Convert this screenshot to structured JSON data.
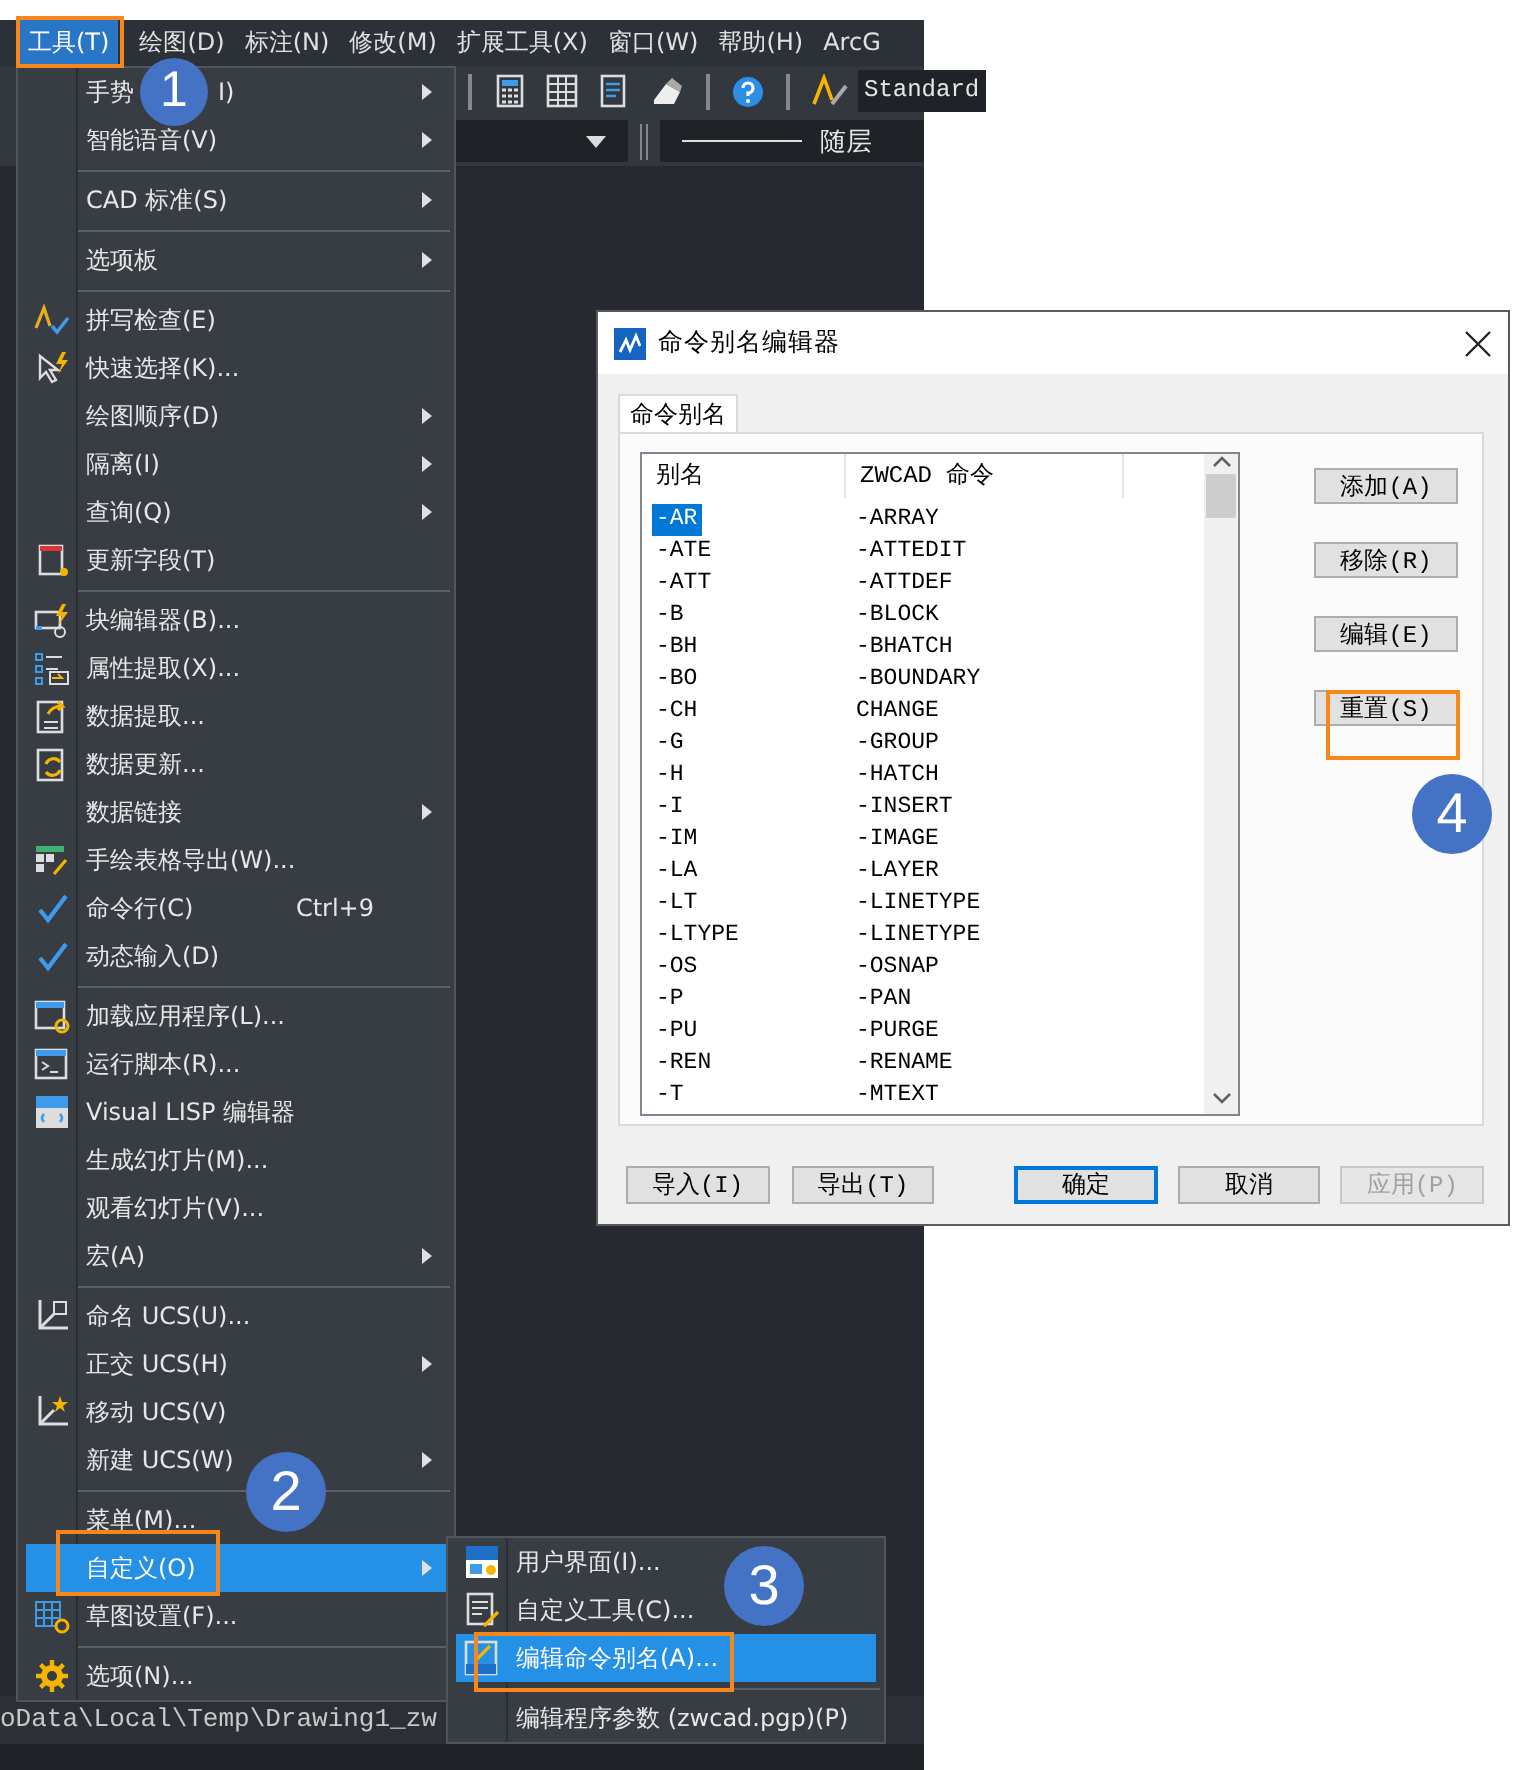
{
  "menu_bar": {
    "items": [
      {
        "label": "工具(T)",
        "selected": true
      },
      {
        "label": "绘图(D)",
        "selected": false
      },
      {
        "label": "标注(N)",
        "selected": false
      },
      {
        "label": "修改(M)",
        "selected": false
      },
      {
        "label": "扩展工具(X)",
        "selected": false
      },
      {
        "label": "窗口(W)",
        "selected": false
      },
      {
        "label": "帮助(H)",
        "selected": false
      },
      {
        "label": "ArcG",
        "selected": false
      }
    ]
  },
  "toolbar": {
    "text_style": "Standard",
    "linetype": "随层"
  },
  "tools_menu": {
    "items": [
      {
        "kind": "command",
        "label": "手势",
        "label_end": "I)",
        "submenu": true,
        "checked": false,
        "selected": false
      },
      {
        "kind": "command",
        "label": "智能语音(V)",
        "submenu": true,
        "checked": false,
        "selected": false
      },
      {
        "kind": "separator"
      },
      {
        "kind": "command",
        "label": "CAD 标准(S)",
        "submenu": true,
        "checked": false,
        "selected": false
      },
      {
        "kind": "separator"
      },
      {
        "kind": "command",
        "label": "选项板",
        "submenu": true,
        "checked": false,
        "selected": false
      },
      {
        "kind": "separator"
      },
      {
        "kind": "command",
        "label": "拼写检查(E)",
        "submenu": false,
        "checked": false,
        "selected": false
      },
      {
        "kind": "command",
        "label": "快速选择(K)...",
        "submenu": false,
        "checked": false,
        "selected": false
      },
      {
        "kind": "command",
        "label": "绘图顺序(D)",
        "submenu": true,
        "checked": false,
        "selected": false
      },
      {
        "kind": "command",
        "label": "隔离(I)",
        "submenu": true,
        "checked": false,
        "selected": false
      },
      {
        "kind": "command",
        "label": "查询(Q)",
        "submenu": true,
        "checked": false,
        "selected": false
      },
      {
        "kind": "command",
        "label": "更新字段(T)",
        "submenu": false,
        "checked": false,
        "selected": false
      },
      {
        "kind": "separator"
      },
      {
        "kind": "command",
        "label": "块编辑器(B)...",
        "submenu": false,
        "checked": false,
        "selected": false
      },
      {
        "kind": "command",
        "label": "属性提取(X)...",
        "submenu": false,
        "checked": false,
        "selected": false
      },
      {
        "kind": "command",
        "label": "数据提取...",
        "submenu": false,
        "checked": false,
        "selected": false
      },
      {
        "kind": "command",
        "label": "数据更新...",
        "submenu": false,
        "checked": false,
        "selected": false
      },
      {
        "kind": "command",
        "label": "数据链接",
        "submenu": true,
        "checked": false,
        "selected": false
      },
      {
        "kind": "command",
        "label": "手绘表格导出(W)...",
        "submenu": false,
        "checked": false,
        "selected": false
      },
      {
        "kind": "command",
        "label": "命令行(C)",
        "shortcut": "Ctrl+9",
        "submenu": false,
        "checked": true,
        "selected": false
      },
      {
        "kind": "command",
        "label": "动态输入(D)",
        "submenu": false,
        "checked": true,
        "selected": false
      },
      {
        "kind": "separator"
      },
      {
        "kind": "command",
        "label": "加载应用程序(L)...",
        "submenu": false,
        "checked": false,
        "selected": false
      },
      {
        "kind": "command",
        "label": "运行脚本(R)...",
        "submenu": false,
        "checked": false,
        "selected": false
      },
      {
        "kind": "command",
        "label": "Visual LISP 编辑器",
        "submenu": false,
        "checked": false,
        "selected": false
      },
      {
        "kind": "command",
        "label": "生成幻灯片(M)...",
        "submenu": false,
        "checked": false,
        "selected": false
      },
      {
        "kind": "command",
        "label": "观看幻灯片(V)...",
        "submenu": false,
        "checked": false,
        "selected": false
      },
      {
        "kind": "command",
        "label": "宏(A)",
        "submenu": true,
        "checked": false,
        "selected": false
      },
      {
        "kind": "separator"
      },
      {
        "kind": "command",
        "label": "命名 UCS(U)...",
        "submenu": false,
        "checked": false,
        "selected": false
      },
      {
        "kind": "command",
        "label": "正交 UCS(H)",
        "submenu": true,
        "checked": false,
        "selected": false
      },
      {
        "kind": "command",
        "label": "移动 UCS(V)",
        "submenu": false,
        "checked": false,
        "selected": false
      },
      {
        "kind": "command",
        "label": "新建 UCS(W)",
        "submenu": true,
        "checked": false,
        "selected": false
      },
      {
        "kind": "separator"
      },
      {
        "kind": "command",
        "label": "菜单(M)...",
        "submenu": false,
        "checked": false,
        "selected": false
      },
      {
        "kind": "command",
        "label": "自定义(O)",
        "submenu": true,
        "checked": false,
        "selected": true
      },
      {
        "kind": "command",
        "label": "草图设置(F)...",
        "submenu": false,
        "checked": false,
        "selected": false
      },
      {
        "kind": "separator"
      },
      {
        "kind": "command",
        "label": "选项(N)...",
        "submenu": false,
        "checked": false,
        "selected": false
      }
    ]
  },
  "customize_menu": {
    "items": [
      {
        "kind": "command",
        "label": "用户界面(I)...",
        "submenu": false,
        "checked": false,
        "selected": false
      },
      {
        "kind": "command",
        "label": "自定义工具(C)...",
        "submenu": false,
        "checked": false,
        "selected": false
      },
      {
        "kind": "command",
        "label": "编辑命令别名(A)...",
        "submenu": false,
        "checked": false,
        "selected": true
      },
      {
        "kind": "separator"
      },
      {
        "kind": "command",
        "label": "编辑程序参数 (zwcad.pgp)(P)",
        "submenu": false,
        "checked": false,
        "selected": false
      }
    ]
  },
  "dialog": {
    "title": "命令别名编辑器",
    "tabs": [
      {
        "label": "命令别名",
        "selected": true
      }
    ],
    "table": {
      "columns": [
        "别名",
        "ZWCAD 命令"
      ],
      "rows": [
        {
          "alias": "-AR",
          "command": "-ARRAY",
          "selected": true
        },
        {
          "alias": "-ATE",
          "command": "-ATTEDIT",
          "selected": false
        },
        {
          "alias": "-ATT",
          "command": "-ATTDEF",
          "selected": false
        },
        {
          "alias": "-B",
          "command": "-BLOCK",
          "selected": false
        },
        {
          "alias": "-BH",
          "command": "-BHATCH",
          "selected": false
        },
        {
          "alias": "-BO",
          "command": "-BOUNDARY",
          "selected": false
        },
        {
          "alias": "-CH",
          "command": "CHANGE",
          "selected": false
        },
        {
          "alias": "-G",
          "command": "-GROUP",
          "selected": false
        },
        {
          "alias": "-H",
          "command": "-HATCH",
          "selected": false
        },
        {
          "alias": "-I",
          "command": "-INSERT",
          "selected": false
        },
        {
          "alias": "-IM",
          "command": "-IMAGE",
          "selected": false
        },
        {
          "alias": "-LA",
          "command": "-LAYER",
          "selected": false
        },
        {
          "alias": "-LT",
          "command": "-LINETYPE",
          "selected": false
        },
        {
          "alias": "-LTYPE",
          "command": "-LINETYPE",
          "selected": false
        },
        {
          "alias": "-OS",
          "command": "-OSNAP",
          "selected": false
        },
        {
          "alias": "-P",
          "command": "-PAN",
          "selected": false
        },
        {
          "alias": "-PU",
          "command": "-PURGE",
          "selected": false
        },
        {
          "alias": "-REN",
          "command": "-RENAME",
          "selected": false
        },
        {
          "alias": "-T",
          "command": "-MTEXT",
          "selected": false
        }
      ]
    },
    "side_buttons": [
      {
        "label": "添加(A)"
      },
      {
        "label": "移除(R)"
      },
      {
        "label": "编辑(E)"
      },
      {
        "label": "重置(S)"
      }
    ],
    "bottom_buttons": [
      {
        "label": "导入(I)",
        "default": false,
        "disabled": false
      },
      {
        "label": "导出(T)",
        "default": false,
        "disabled": false
      },
      {
        "label": "确定",
        "default": true,
        "disabled": false
      },
      {
        "label": "取消",
        "default": false,
        "disabled": false
      },
      {
        "label": "应用(P)",
        "default": false,
        "disabled": true
      }
    ]
  },
  "status_bar": {
    "path": "oData\\Local\\Temp\\Drawing1_zw"
  },
  "callouts": [
    {
      "number": "1",
      "framed": true
    },
    {
      "number": "2",
      "framed": true
    },
    {
      "number": "3",
      "framed": true
    },
    {
      "number": "4",
      "framed": true
    }
  ]
}
